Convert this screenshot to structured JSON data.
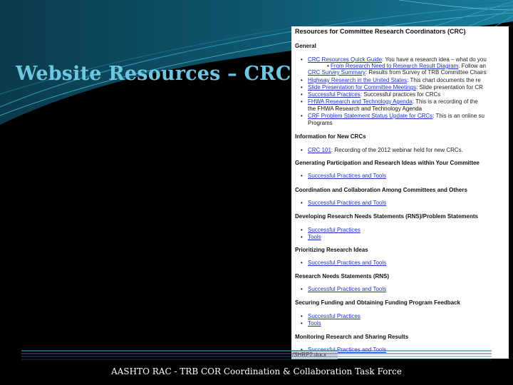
{
  "slide": {
    "title": "Website Resources – CRC",
    "footer": "AASHTO RAC - TRB COR Coordination & Collaboration Task Force"
  },
  "screenshot": {
    "heading": "Resources for Committee Research Coordinators (CRC)",
    "filename_tab": "/SHRP2.docx",
    "general": {
      "title": "General",
      "items": [
        {
          "link": "CRC Resources Quick Guide",
          "text": ": You have a research idea – what do you"
        },
        {
          "link": "CRC Survey Summary",
          "text": ": Results from Survey of TRB Committee Chairs"
        },
        {
          "link": "Highway Research in the United States",
          "text": ": This chart documents the re"
        },
        {
          "link": "Slide Presentation for Committee Meetings",
          "text": ": Slide presentation for CR"
        },
        {
          "link": "Successful Practices",
          "text": ": Successful practices for CRCs"
        },
        {
          "link": "FHWA Research and Technology Agenda",
          "text": ": This is a recording of the"
        },
        {
          "link": "CRF Problem Statement Status Update for CRCs",
          "text": ": This is an online su"
        }
      ],
      "sub_item": {
        "prefix": "•",
        "link": "From Research Need to Research Result Diagram",
        "text": ". Follow an"
      },
      "continuation_1": "the FHWA Research and Technology Agenda",
      "continuation_2": "Programs"
    },
    "sections": [
      {
        "title": "Information for New CRCs",
        "items": [
          {
            "link": "CRC 101",
            "text": ": Recording of the 2012 webinar held for new CRCs."
          }
        ]
      },
      {
        "title": "Generating Participation and Research Ideas within Your Committee",
        "items": [
          {
            "link": "Successful Practices and Tools",
            "text": ""
          }
        ]
      },
      {
        "title": "Coordination and Collaboration Among Committees and Others",
        "items": [
          {
            "link": "Successful Practices and Tools",
            "text": ""
          }
        ]
      },
      {
        "title": "Developing Research Needs Statements (RNS)/Problem Statements",
        "items": [
          {
            "link": "Successful Practices",
            "text": ""
          },
          {
            "link": "Tools",
            "text": ""
          }
        ]
      },
      {
        "title": "Prioritizing Research Ideas",
        "items": [
          {
            "link": "Successful Practices and Tools",
            "text": ""
          }
        ]
      },
      {
        "title": "Research Needs Statements (RNS)",
        "items": [
          {
            "link": "Successful Practices and Tools",
            "text": ""
          }
        ]
      },
      {
        "title": "Securing Funding and Obtaining Funding Program Feedback",
        "items": [
          {
            "link": "Successful Practices",
            "text": ""
          },
          {
            "link": "Tools",
            "text": ""
          }
        ]
      },
      {
        "title": "Monitoring Research and Sharing Results",
        "items": [
          {
            "link": "Successful Practices and Tools",
            "text": ""
          }
        ]
      }
    ]
  },
  "colors": {
    "title": "#6fc6e0",
    "background": "#000000",
    "link": "#1a35c4",
    "accent_lines": "#2a8fb0"
  }
}
